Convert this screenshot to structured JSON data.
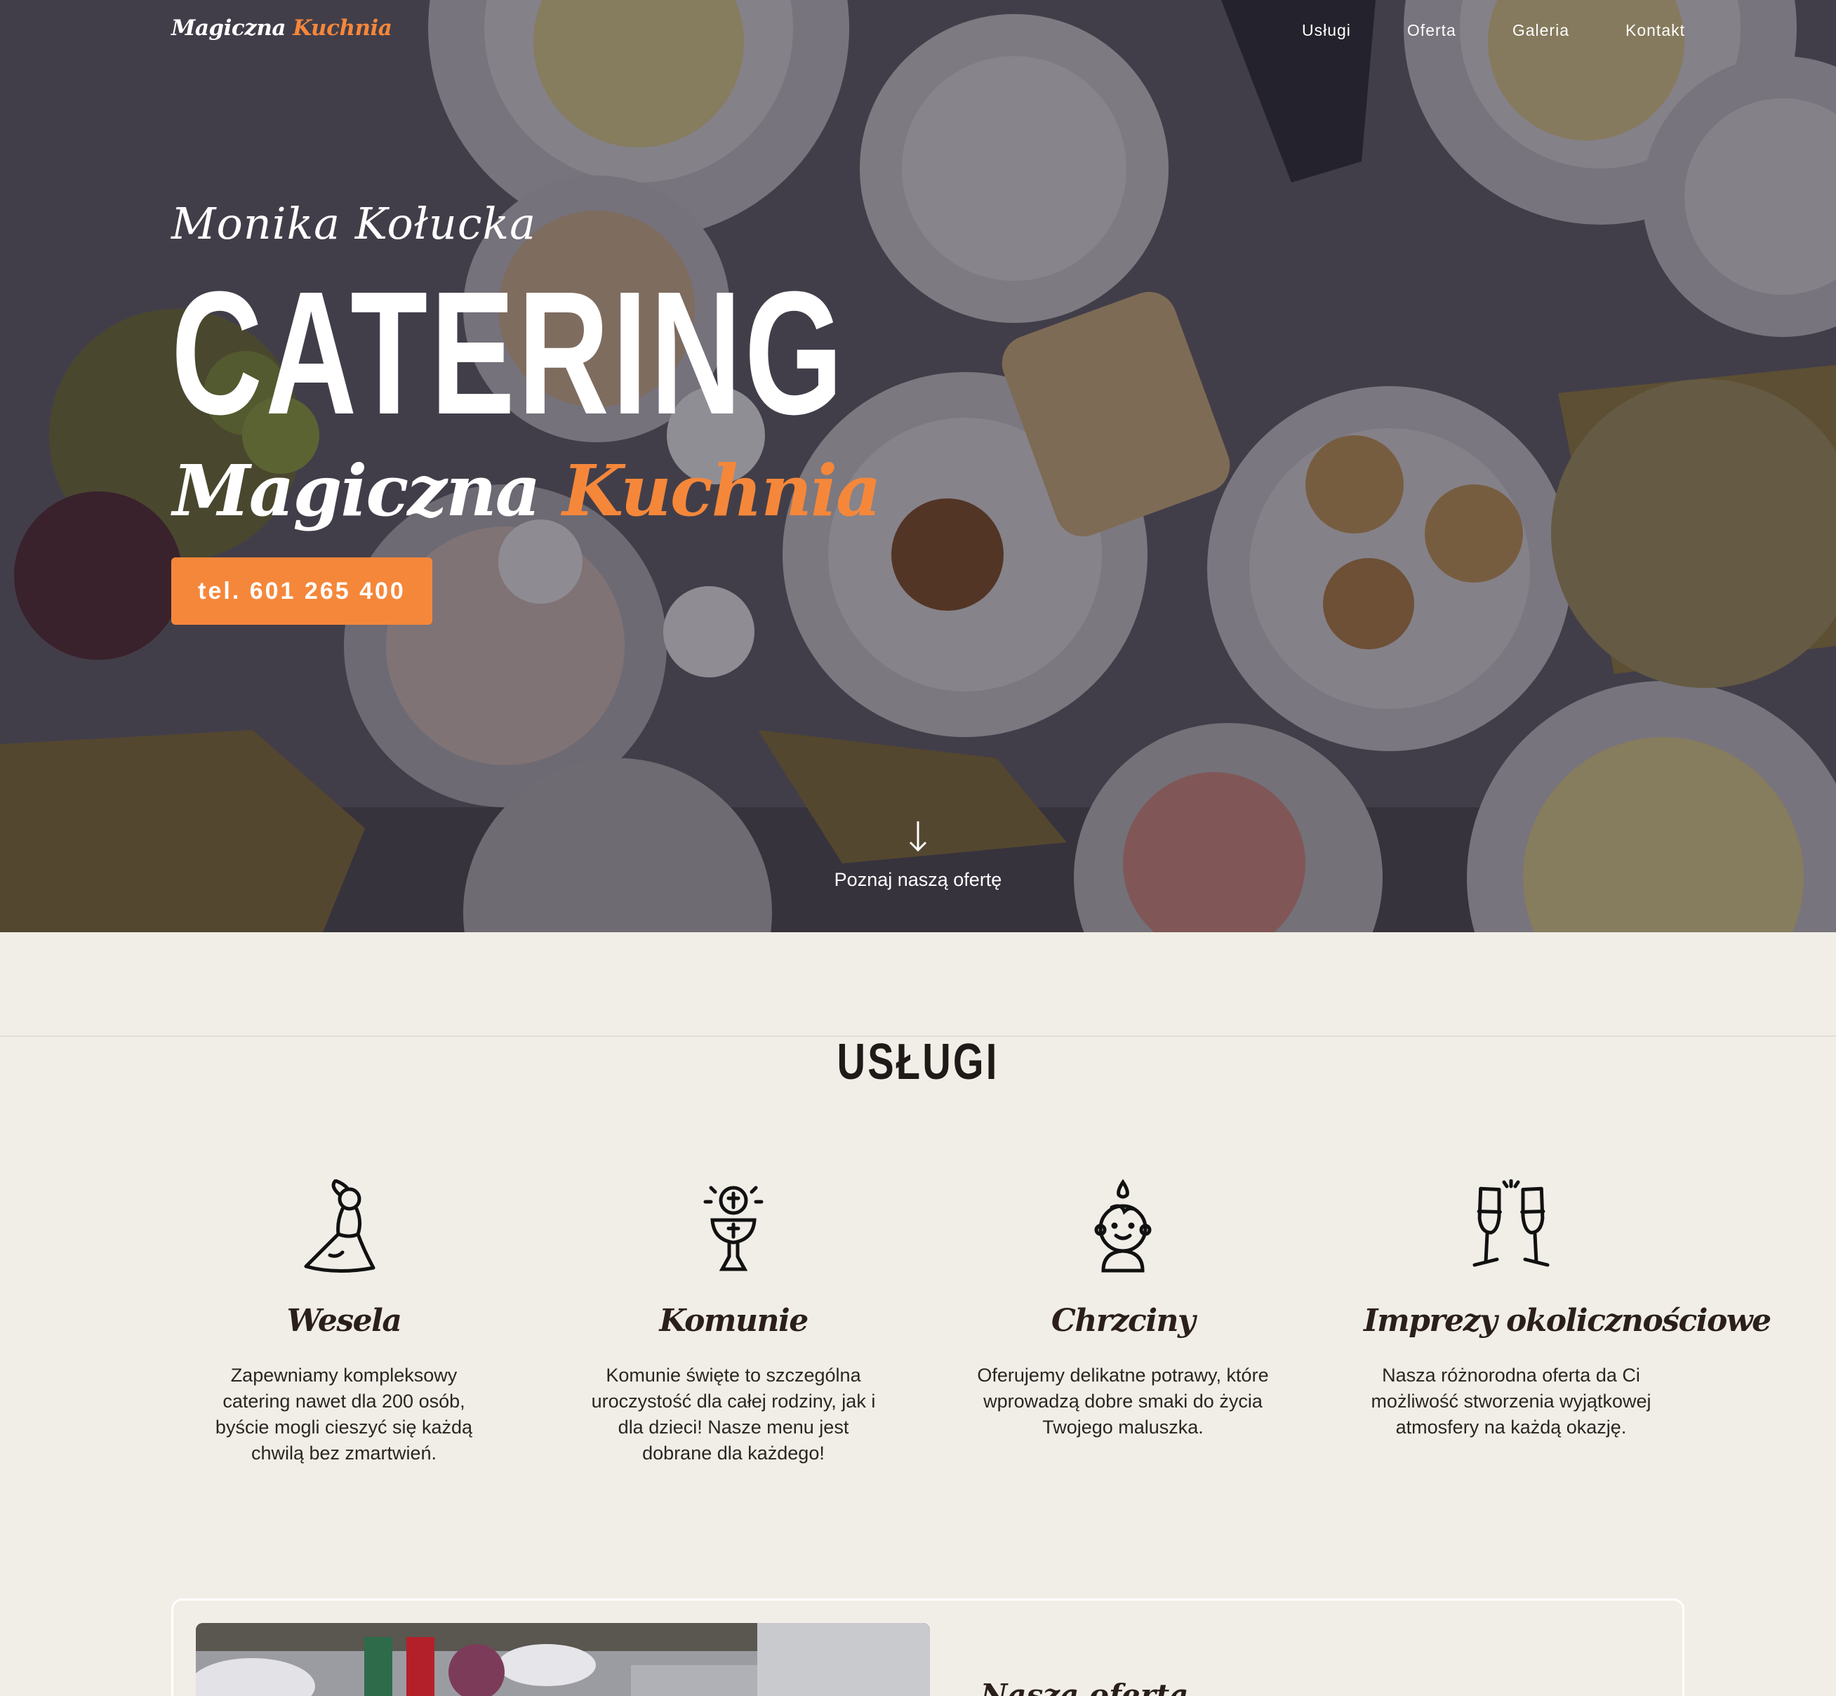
{
  "header": {
    "logo_part1": "Magiczna",
    "logo_part2": "Kuchnia",
    "nav": [
      "Usługi",
      "Oferta",
      "Galeria",
      "Kontakt"
    ]
  },
  "hero": {
    "owner": "Monika Kołucka",
    "title": "CATERING",
    "brand_part1": "Magiczna",
    "brand_part2": "Kuchnia",
    "phone_button": "tel. 601 265 400",
    "scroll_label": "Poznaj naszą ofertę",
    "scroll_icon": "arrow-down-icon"
  },
  "services": {
    "title": "USŁUGI",
    "items": [
      {
        "icon": "bride-icon",
        "title": "Wesela",
        "text": "Zapewniamy kompleksowy catering nawet dla 200 osób, byście mogli cieszyć się każdą chwilą bez zmartwień."
      },
      {
        "icon": "chalice-icon",
        "title": "Komunie",
        "text": "Komunie święte to szczególna uroczystość dla całej rodziny, jak i dla dzieci! Nasze menu jest dobrane dla każdego!"
      },
      {
        "icon": "baby-icon",
        "title": "Chrzciny",
        "text": "Oferujemy delikatne potrawy, które wprowadzą dobre smaki do życia Twojego maluszka."
      },
      {
        "icon": "champagne-glasses-icon",
        "title": "Imprezy okolicznościowe",
        "text": "Nasza różnorodna oferta da Ci możliwość stworzenia wyjątkowej atmosfery na każdą okazję."
      }
    ]
  },
  "offer": {
    "title": "Nasza oferta"
  },
  "colors": {
    "accent": "#f5873a",
    "background": "#f1eee7",
    "dark_text": "#1f1a17"
  }
}
